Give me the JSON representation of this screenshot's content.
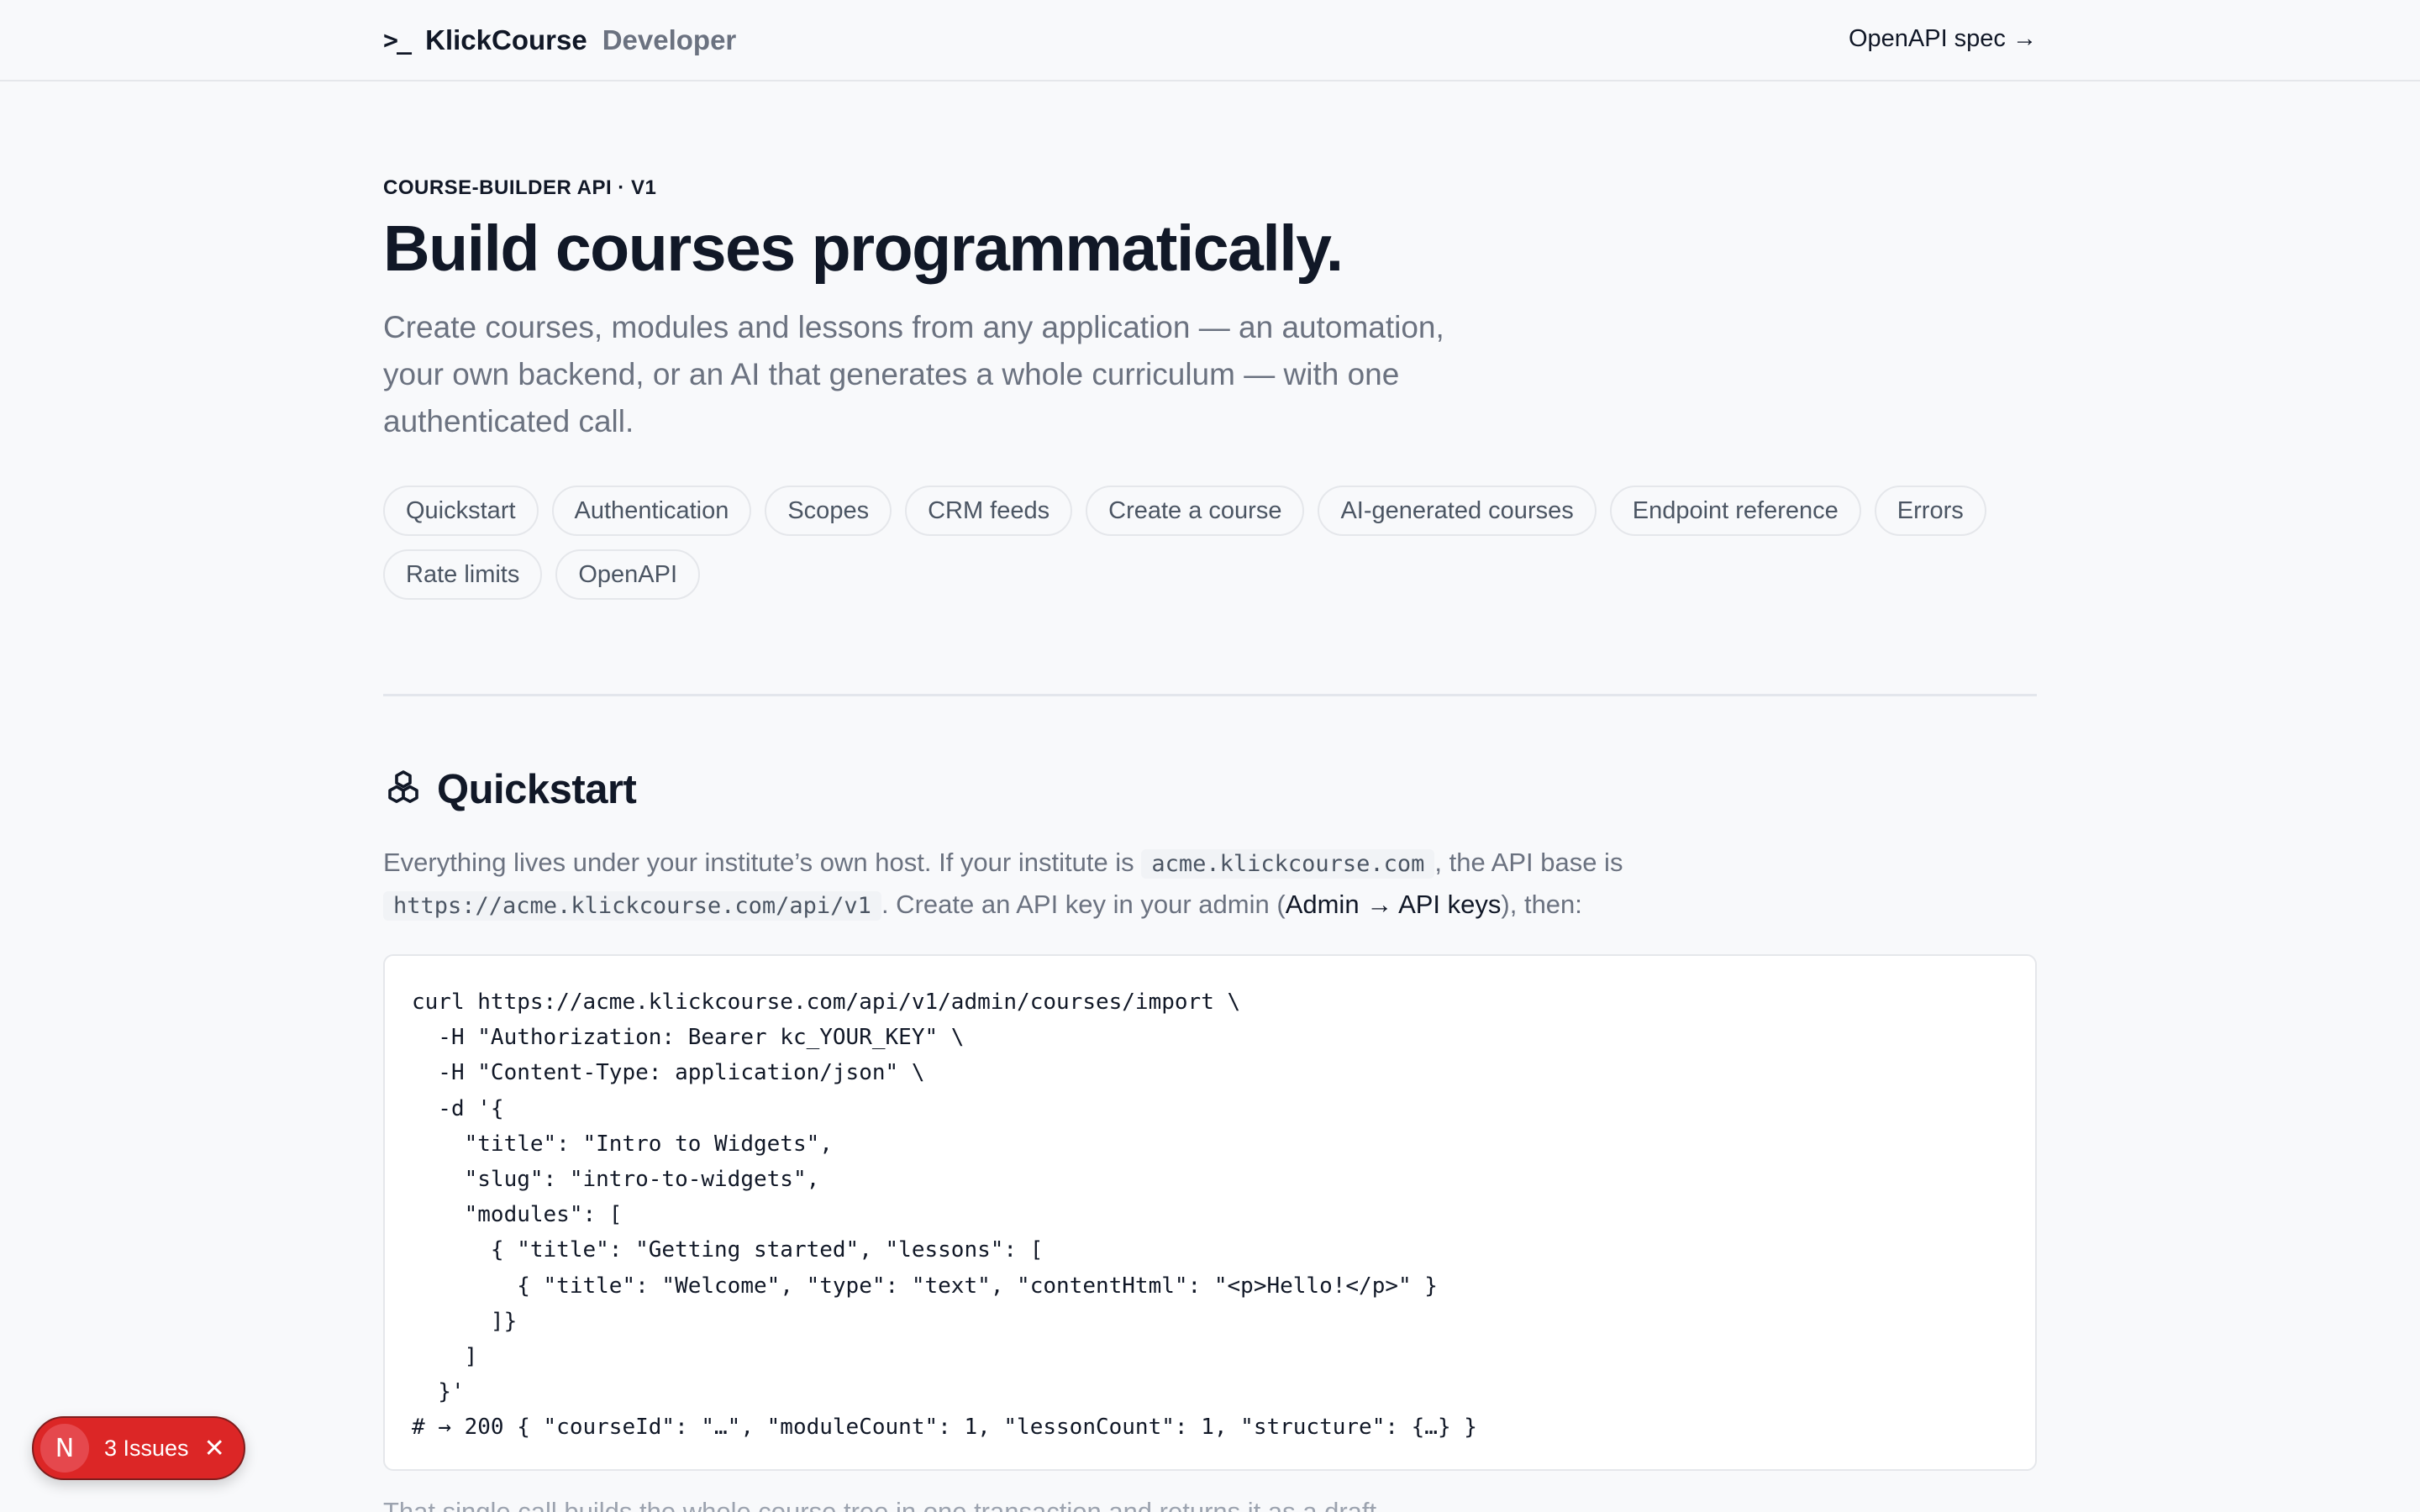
{
  "header": {
    "logo_glyph": ">_",
    "brand_name": "KlickCourse",
    "brand_sub": "Developer",
    "spec_link": "OpenAPI spec →"
  },
  "hero": {
    "eyebrow": "COURSE-BUILDER API · V1",
    "title": "Build courses programmatically.",
    "lead": "Create courses, modules and lessons from any application — an automation, your own backend, or an AI that generates a whole curriculum — with one authenticated call."
  },
  "nav_pills": [
    "Quickstart",
    "Authentication",
    "Scopes",
    "CRM feeds",
    "Create a course",
    "AI-generated courses",
    "Endpoint reference",
    "Errors",
    "Rate limits",
    "OpenAPI"
  ],
  "quickstart": {
    "title": "Quickstart",
    "icon": "cubes-icon",
    "text_part1": "Everything lives under your institute’s own host. If your institute is ",
    "host_code": "acme.klickcourse.com",
    "text_part2": ", the API base is ",
    "base_code": "https://acme.klickcourse.com/api/v1",
    "text_part3": ". Create an API key in your admin (",
    "admin_path": "Admin → API keys",
    "text_part4": "), then:",
    "code": "curl https://acme.klickcourse.com/api/v1/admin/courses/import \\\n  -H \"Authorization: Bearer kc_YOUR_KEY\" \\\n  -H \"Content-Type: application/json\" \\\n  -d '{\n    \"title\": \"Intro to Widgets\",\n    \"slug\": \"intro-to-widgets\",\n    \"modules\": [\n      { \"title\": \"Getting started\", \"lessons\": [\n        { \"title\": \"Welcome\", \"type\": \"text\", \"contentHtml\": \"<p>Hello!</p>\" }\n      ]}\n    ]\n  }'\n# → 200 { \"courseId\": \"…\", \"moduleCount\": 1, \"lessonCount\": 1, \"structure\": {…} }",
    "next_line": "That single call builds the whole course tree in one transaction and returns it as a draft."
  },
  "issues_badge": {
    "avatar": "N",
    "label": "3 Issues",
    "close": "✕",
    "color": "#dc2626"
  }
}
